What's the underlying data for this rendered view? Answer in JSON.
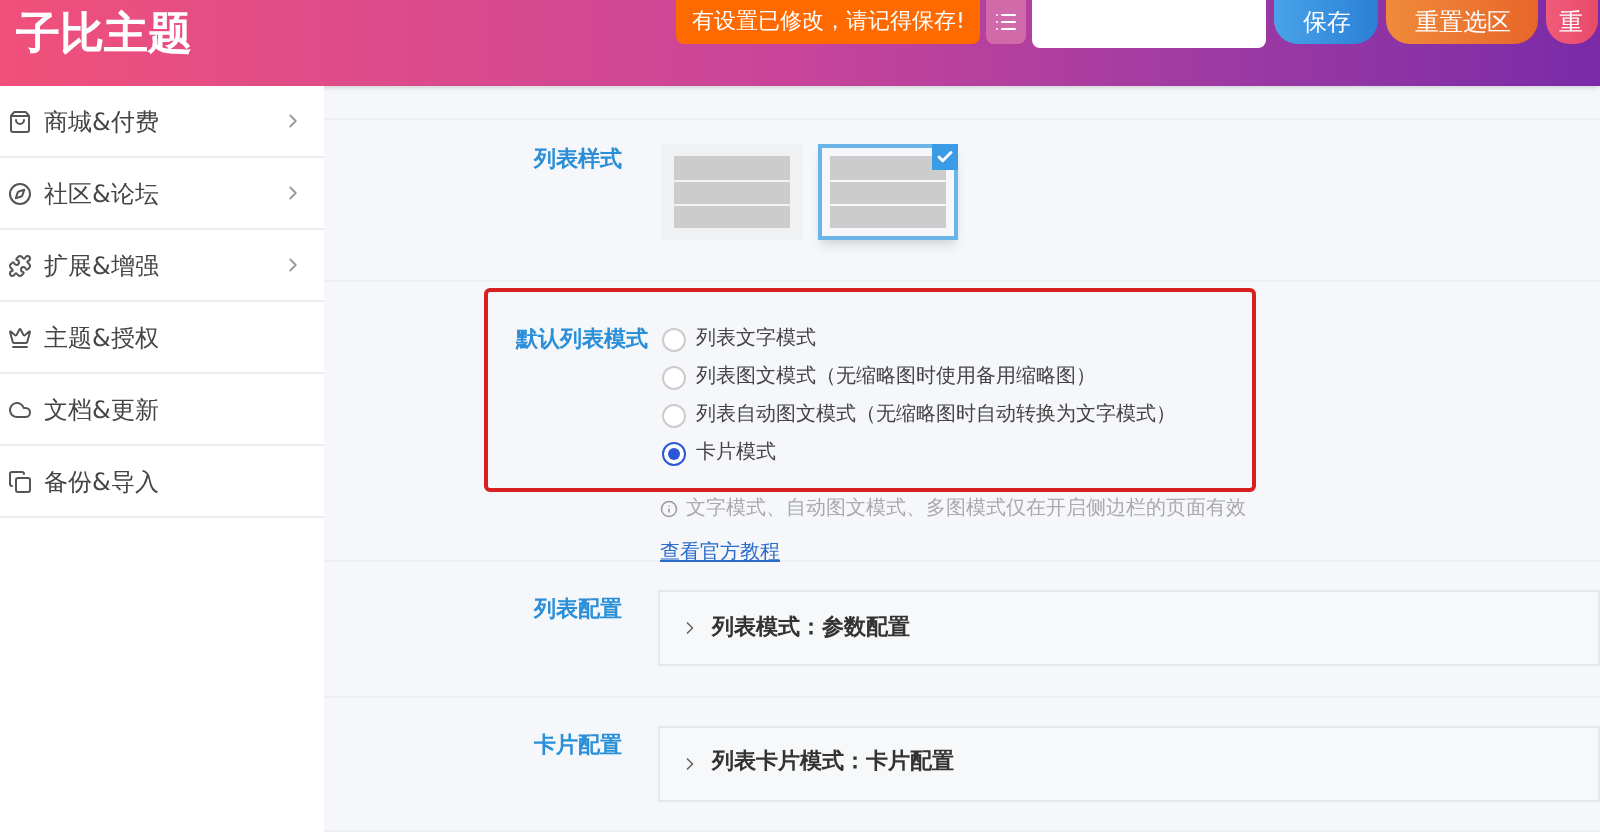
{
  "header": {
    "title": "子比主题",
    "notice": "有设置已修改，请记得保存!",
    "buttons": [
      {
        "label": "保存",
        "kind": "save"
      },
      {
        "label": "重置选区",
        "kind": "reset_section"
      },
      {
        "label": "重",
        "kind": "reset_all"
      }
    ]
  },
  "sidebar": {
    "items": [
      {
        "label": "商城&付费",
        "has_arrow": true
      },
      {
        "label": "社区&论坛",
        "has_arrow": true
      },
      {
        "label": "扩展&增强",
        "has_arrow": true
      },
      {
        "label": "主题&授权",
        "has_arrow": false
      },
      {
        "label": "文档&更新",
        "has_arrow": false
      },
      {
        "label": "备份&导入",
        "has_arrow": false
      }
    ]
  },
  "list_style": {
    "label": "列表样式",
    "options": [
      {
        "selected": false
      },
      {
        "selected": true
      }
    ]
  },
  "default_mode": {
    "label": "默认列表模式",
    "highlighted": true,
    "options": [
      {
        "label": "列表文字模式",
        "selected": false
      },
      {
        "label": "列表图文模式（无缩略图时使用备用缩略图）",
        "selected": false
      },
      {
        "label": "列表自动图文模式（无缩略图时自动转换为文字模式）",
        "selected": false
      },
      {
        "label": "卡片模式",
        "selected": true
      }
    ],
    "hint": "文字模式、自动图文模式、多图模式仅在开启侧边栏的页面有效",
    "link": "查看官方教程"
  },
  "sections": [
    {
      "label": "列表配置",
      "panel": "列表模式：参数配置"
    },
    {
      "label": "卡片配置",
      "panel": "列表卡片模式：卡片配置"
    }
  ]
}
